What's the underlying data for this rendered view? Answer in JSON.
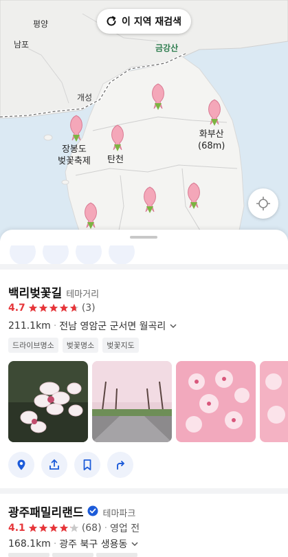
{
  "map": {
    "research_button_label": "이 지역 재검색",
    "labels": {
      "pyongyang": "평양",
      "nampo": "남포",
      "geumgangsan": "금강산",
      "kaesong": "개성",
      "jangbongdo_line1": "장봉도",
      "jangbongdo_line2": "벚꽃축제",
      "tancheon": "탄천",
      "hwabusan_line1": "화부산",
      "hwabusan_line2": "(68m)"
    },
    "icons": {
      "research": "refresh-icon",
      "pin": "cherry-blossom-pin-icon",
      "locate": "my-location-icon"
    },
    "colors": {
      "pin": "#f4a7b9",
      "land": "#f4f4f2",
      "sea": "#dbe9f3"
    }
  },
  "places": [
    {
      "name": "백리벚꽃길",
      "category": "테마거리",
      "rating": "4.7",
      "stars": 4.7,
      "review_count": "(3)",
      "distance": "211.1km",
      "address": "전남 영암군 군서면 월곡리",
      "tags": [
        "드라이브명소",
        "벚꽃명소",
        "벚꽃지도"
      ]
    },
    {
      "name": "광주패밀리랜드",
      "category": "테마파크",
      "rating": "4.1",
      "stars": 4.1,
      "review_count": "(68)",
      "status": "영업 전",
      "distance": "168.1km",
      "address": "광주 북구 생용동",
      "verified": true
    }
  ],
  "action_icons": [
    "map-pin-icon",
    "share-icon",
    "bookmark-icon",
    "directions-icon"
  ],
  "colors": {
    "accent": "#1c5bd9",
    "rating": "#e6363a",
    "star_empty": "#c9c9c9"
  }
}
